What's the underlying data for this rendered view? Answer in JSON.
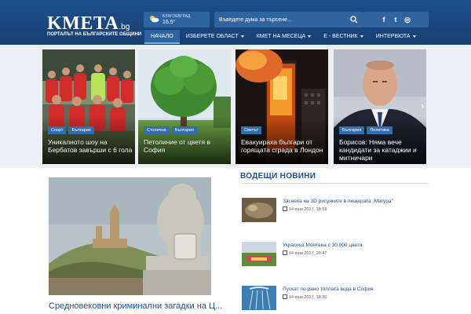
{
  "header": {
    "logo_main": "KMETA",
    "logo_tld": ".bg",
    "tagline": "ПОРТАЛЪТ НА БЪЛГАРСКИТЕ ОБЩИНИ",
    "weather": {
      "city": "БЛАГОЕВГРАД",
      "temp": "16.5°",
      "icon": "partly-cloudy-icon"
    },
    "search": {
      "placeholder": "Въведете дума за търсене..."
    },
    "social": [
      {
        "label": "f",
        "icon": "facebook-icon"
      },
      {
        "label": "t",
        "icon": "twitter-icon"
      },
      {
        "label": "◎",
        "icon": "instagram-icon"
      }
    ]
  },
  "nav": {
    "items": [
      {
        "label": "НАЧАЛО",
        "active": true
      },
      {
        "label": "ИЗБЕРЕТЕ ОБЛАСТ",
        "dropdown": true
      },
      {
        "label": "КМЕТ НА МЕСЕЦА",
        "dropdown": true
      },
      {
        "label": "Е - ВЕСТНИК",
        "dropdown": true
      },
      {
        "label": "ИНТЕРВЮТА",
        "dropdown": true
      }
    ]
  },
  "slider": {
    "cards": [
      {
        "tags": [
          "Спорт",
          "България"
        ],
        "title": "Уникалното шоу на Бербатов завърши с 6 гола"
      },
      {
        "tags": [
          "Столична",
          "България"
        ],
        "title": "Петолиние от цветя в София"
      },
      {
        "tags": [
          "Светът"
        ],
        "title": "Евакуираха българи от горящата сграда в Лондон"
      },
      {
        "tags": [
          "България",
          "Политика"
        ],
        "title": "Борисов: Няма вече кандидати за катаджии и митничари"
      }
    ],
    "next_icon": "chevron-right-icon"
  },
  "featured": {
    "title": "Средновековни криминални загадки на Ц..."
  },
  "leading_news": {
    "heading": "ВОДЕЩИ НОВИНИ",
    "items": [
      {
        "title": "Заснеха на 3D рисунките в пещерата „Магура“",
        "date": "14 юни 2017, 18:59"
      },
      {
        "title": "Украсиха Монтана с 30 000 цветя",
        "date": "14 юни 2017, 20:47"
      },
      {
        "title": "Пускат по-рано топлата вода в София",
        "date": "14 юни 2017, 18:30"
      }
    ]
  },
  "colors": {
    "header": "#1d4f8a",
    "accent": "#2f649f",
    "tag": "#2f6fb0",
    "band": "#eceff3"
  }
}
